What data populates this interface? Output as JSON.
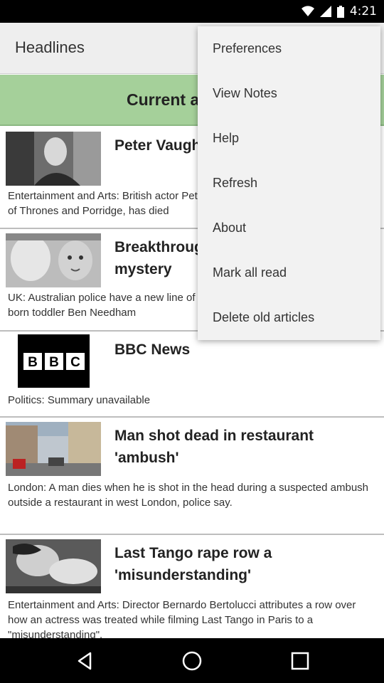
{
  "status_bar": {
    "time": "4:21"
  },
  "header": {
    "title": "Headlines"
  },
  "section": {
    "label": "Current affairs"
  },
  "articles": [
    {
      "headline": "Peter Vaughan, Porridge star, dies",
      "summary": "Entertainment and Arts: British actor Peter Vaughan, known for roles in Game of Thrones and Porridge, has died"
    },
    {
      "headline": "Breakthrough in Ben Needham mystery",
      "summary": "UK: Australian police have a new line of inquiry into the disappearance of UK-born toddler Ben Needham"
    },
    {
      "headline": "BBC News",
      "summary": "Politics: Summary unavailable",
      "logo_text": "BBC"
    },
    {
      "headline": "Man shot dead in restaurant 'ambush'",
      "summary": "London: A man dies when he is shot in the head during a suspected ambush outside a restaurant in west London, police say."
    },
    {
      "headline": "Last Tango rape row a 'misunderstanding'",
      "summary": "Entertainment and Arts: Director Bernardo Bertolucci attributes a row over how an actress was treated while filming Last Tango in Paris to a \"misunderstanding\"."
    }
  ],
  "menu": {
    "items": [
      "Preferences",
      "View Notes",
      "Help",
      "Refresh",
      "About",
      "Mark all read",
      "Delete old articles"
    ]
  },
  "nav": {
    "icons": [
      "back-icon",
      "home-icon",
      "recents-icon"
    ]
  }
}
